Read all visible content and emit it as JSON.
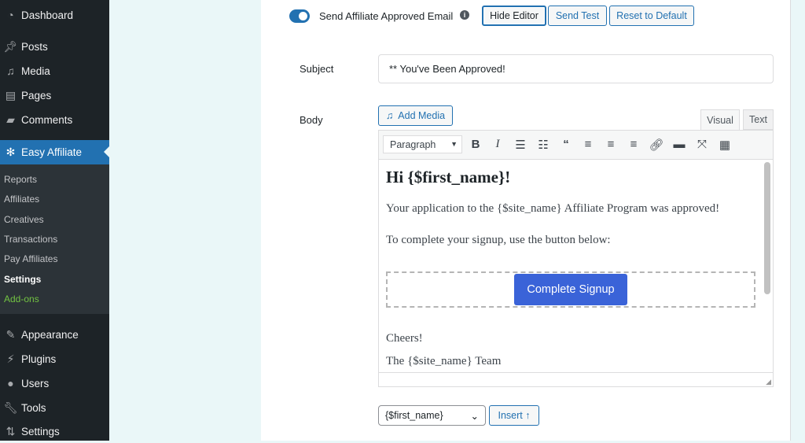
{
  "sidebar": {
    "menu": [
      {
        "label": "Dashboard",
        "icon": "dashboard-icon"
      },
      {
        "label": "Posts",
        "icon": "pin-icon"
      },
      {
        "label": "Media",
        "icon": "media-icon"
      },
      {
        "label": "Pages",
        "icon": "pages-icon"
      },
      {
        "label": "Comments",
        "icon": "comment-icon"
      },
      {
        "label": "Easy Affiliate",
        "icon": "easy-affiliate-icon"
      },
      {
        "label": "Appearance",
        "icon": "brush-icon"
      },
      {
        "label": "Plugins",
        "icon": "plugin-icon"
      },
      {
        "label": "Users",
        "icon": "user-icon"
      },
      {
        "label": "Tools",
        "icon": "wrench-icon"
      },
      {
        "label": "Settings",
        "icon": "settings-icon"
      }
    ],
    "submenu": [
      "Reports",
      "Affiliates",
      "Creatives",
      "Transactions",
      "Pay Affiliates",
      "Settings",
      "Add-ons"
    ]
  },
  "email": {
    "toggle_on": true,
    "label": "Send Affiliate Approved Email",
    "hide_editor": "Hide Editor",
    "send_test": "Send Test",
    "reset": "Reset to Default",
    "subject_label": "Subject",
    "subject_value": "** You've Been Approved!",
    "body_label": "Body",
    "add_media": "Add Media",
    "tab_visual": "Visual",
    "tab_text": "Text",
    "format": "Paragraph",
    "content": {
      "heading": "Hi {$first_name}!",
      "p1": "Your application to the {$site_name} Affiliate Program was approved!",
      "p2": "To complete your signup, use the button below:",
      "button": "Complete Signup",
      "cheers": "Cheers!",
      "team": "The {$site_name} Team"
    },
    "variable_select": "{$first_name}",
    "insert": "Insert ↑"
  },
  "colors": {
    "accent": "#2271b1",
    "cta": "#3a63d8",
    "addon": "#72c242"
  }
}
